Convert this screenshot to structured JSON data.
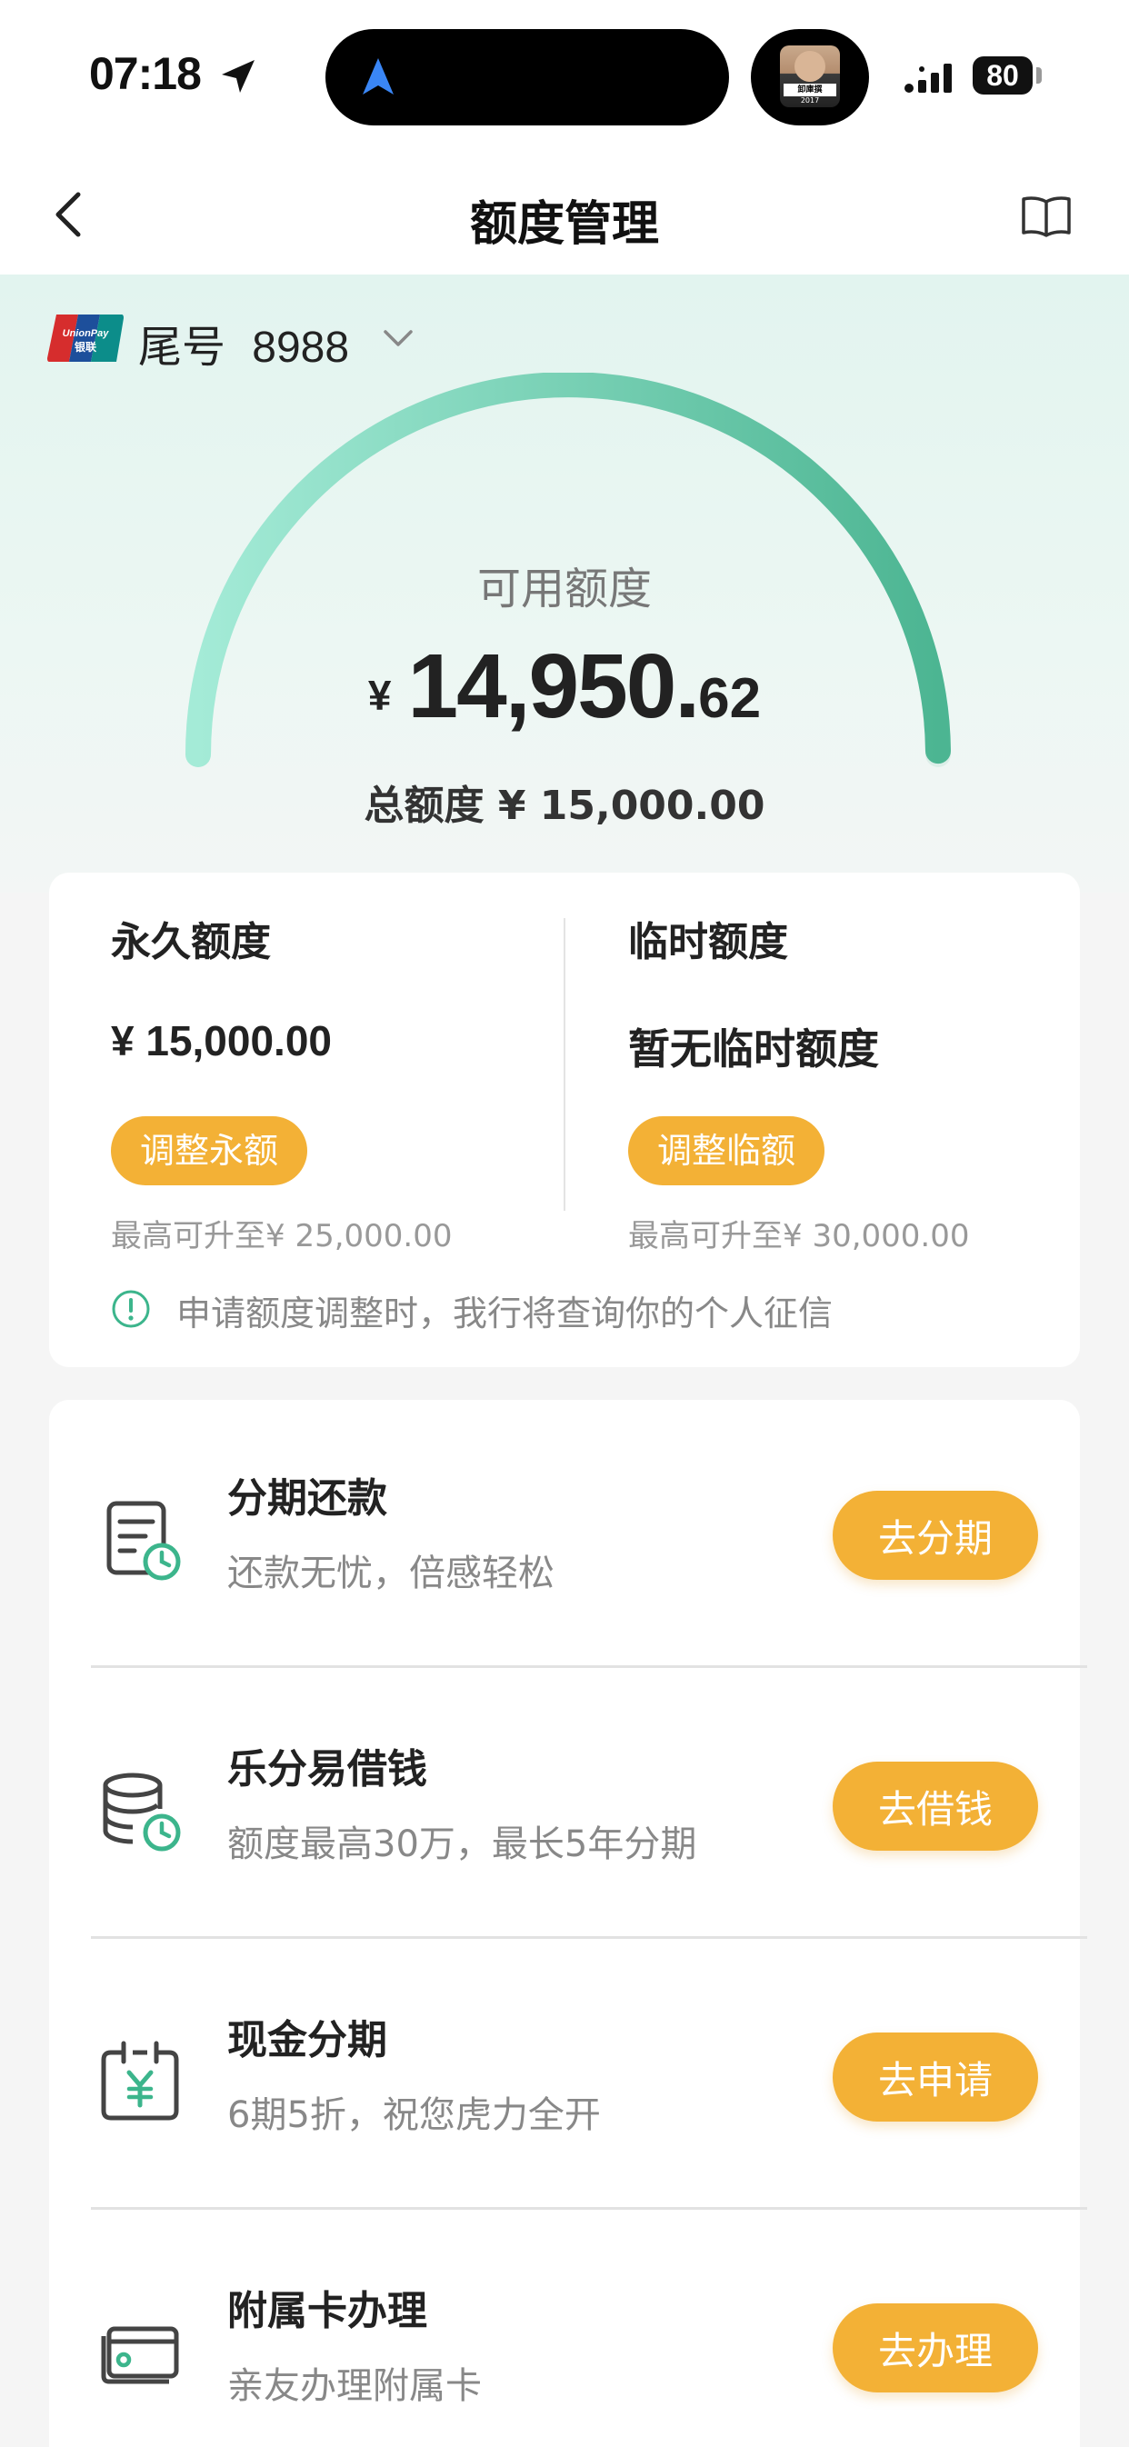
{
  "status_bar": {
    "time": "07:18",
    "battery": "80",
    "avatar_tag": "卸庫撰",
    "avatar_year": "2017",
    "icons": [
      "location-arrow-icon",
      "navigation-icon",
      "signal-icon",
      "battery-icon"
    ]
  },
  "nav": {
    "title": "额度管理",
    "back_icon": "chevron-left-icon",
    "guide_icon": "book-icon"
  },
  "hero": {
    "card_suffix_label": "尾号",
    "card_number": "8988",
    "available_label": "可用额度",
    "currency": "¥",
    "available_int": "14,950.",
    "available_dec": "62",
    "total_line": "总额度 ¥ 15,000.00",
    "available_fraction": 0.9967
  },
  "limits": {
    "permanent": {
      "title": "永久额度",
      "value": "¥ 15,000.00",
      "button": "调整永额",
      "max": "最高可升至¥ 25,000.00"
    },
    "temporary": {
      "title": "临时额度",
      "value": "暂无临时额度",
      "button": "调整临额",
      "max": "最高可升至¥ 30,000.00"
    },
    "notice": "申请额度调整时，我行将查询你的个人征信"
  },
  "services": [
    {
      "title": "分期还款",
      "subtitle": "还款无忧，倍感轻松",
      "button": "去分期",
      "icon": "bill-clock-icon"
    },
    {
      "title": "乐分易借钱",
      "subtitle": "额度最高30万，最长5年分期",
      "button": "去借钱",
      "icon": "coins-clock-icon"
    },
    {
      "title": "现金分期",
      "subtitle": "6期5折，祝您虎力全开",
      "button": "去申请",
      "icon": "calendar-yuan-icon"
    },
    {
      "title": "附属卡办理",
      "subtitle": "亲友办理附属卡",
      "button": "去办理",
      "icon": "card-icon"
    }
  ],
  "colors": {
    "accent_orange": "#f3b136",
    "gauge_start": "#9ee6d2",
    "gauge_end": "#4fb893",
    "hero_bg": "#e2f4ef"
  }
}
